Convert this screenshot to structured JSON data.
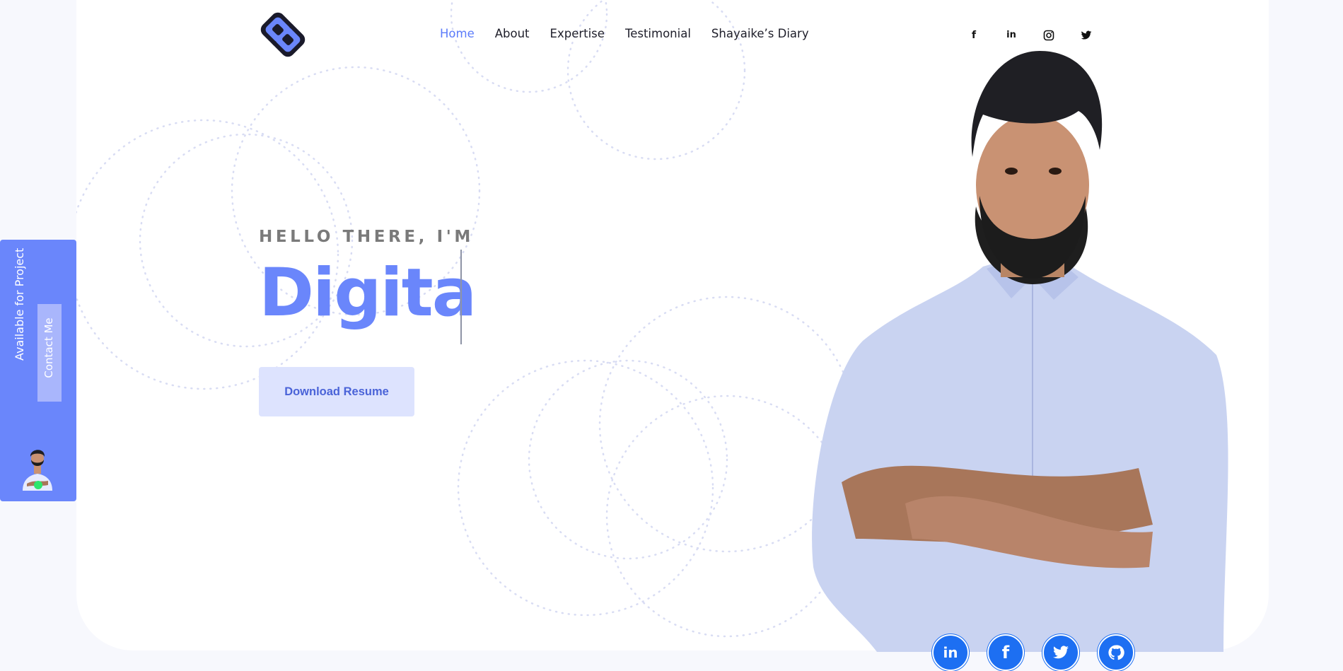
{
  "nav": {
    "items": [
      {
        "label": "Home",
        "active": true
      },
      {
        "label": "About",
        "active": false
      },
      {
        "label": "Expertise",
        "active": false
      },
      {
        "label": "Testimonial",
        "active": false
      },
      {
        "label": "Shayaike’s Diary",
        "active": false
      }
    ]
  },
  "social_top": {
    "icons": [
      "facebook-icon",
      "linkedin-icon",
      "instagram-icon",
      "twitter-icon"
    ],
    "facebook_glyph": "f",
    "linkedin_glyph": "in"
  },
  "hero": {
    "greeting": "HELLO THERE, I'M",
    "typed_text": "Digita",
    "resume_button": "Download Resume"
  },
  "side_panel": {
    "availability": "Available for Project",
    "contact_button": "Contact Me"
  },
  "social_bottom": {
    "icons": [
      "linkedin-icon",
      "facebook-icon",
      "twitter-icon",
      "github-icon"
    ],
    "linkedin_glyph": "in",
    "facebook_glyph": "f"
  },
  "colors": {
    "accent": "#6a86fb",
    "nav_active": "#5c7cfa",
    "button_bg": "#dde3fe",
    "social_bottom": "#1d6ff2",
    "status_online": "#2ee66d"
  }
}
